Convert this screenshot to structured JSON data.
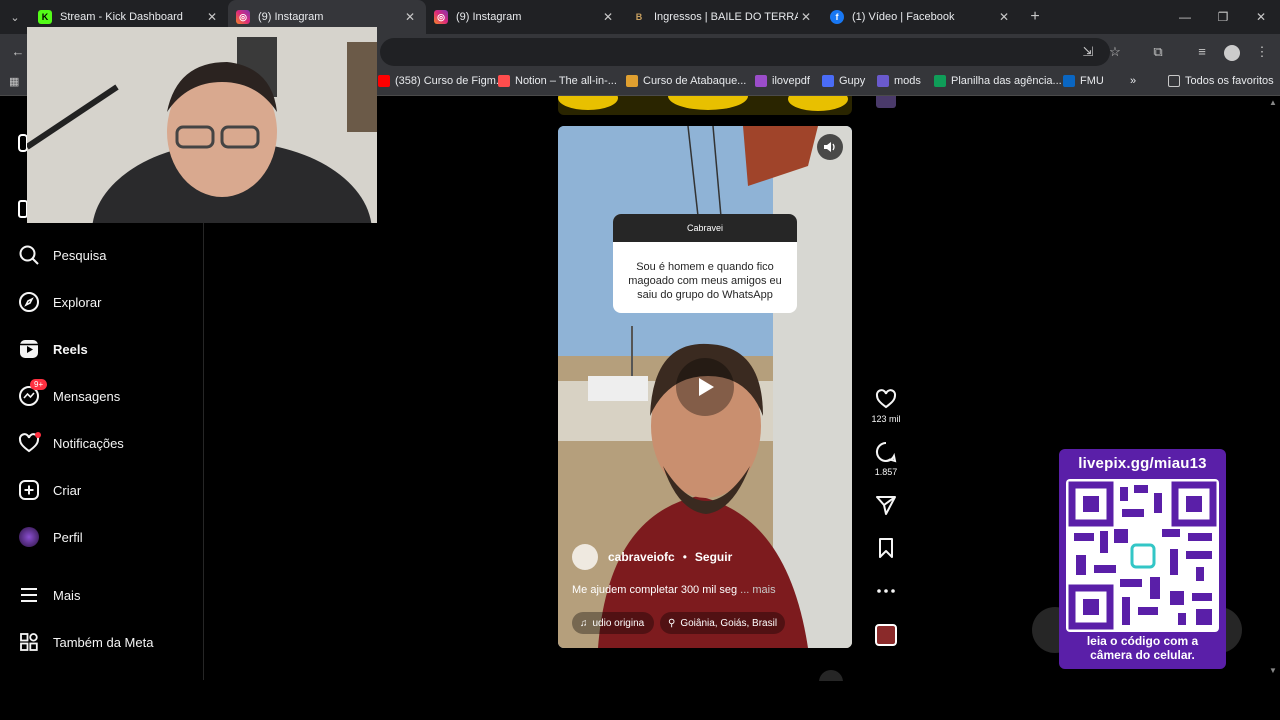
{
  "browser": {
    "tabs": [
      {
        "label": "Stream - Kick Dashboard",
        "icon": "kick-icon",
        "color": "#53fc18"
      },
      {
        "label": "(9) Instagram",
        "icon": "instagram-icon",
        "color": "#e1306c"
      },
      {
        "label": "(9) Instagram",
        "icon": "instagram-icon",
        "color": "#e1306c"
      },
      {
        "label": "Ingressos | BAILE DO TERRAÇO",
        "icon": "ticket-icon",
        "color": "#c8a060"
      },
      {
        "label": "(1) Vídeo | Facebook",
        "icon": "facebook-icon",
        "color": "#1877f2"
      }
    ],
    "bookmarks": [
      {
        "label": "(358) Curso de Figm...",
        "color": "#ff0000"
      },
      {
        "label": "Notion – The all-in-...",
        "color": "#ff4d4d"
      },
      {
        "label": "Curso de Atabaque...",
        "color": "#e0a030"
      },
      {
        "label": "ilovepdf",
        "color": "#9b4dca"
      },
      {
        "label": "Gupy",
        "color": "#4a6cf7"
      },
      {
        "label": "mods",
        "color": "#6a5acd"
      },
      {
        "label": "Planilha das agência...",
        "color": "#0f9d58"
      },
      {
        "label": "FMU",
        "color": "#0a66c2"
      }
    ],
    "all_favorites": "Todos os favoritos",
    "more_chevron": "»"
  },
  "sidebar": {
    "items": [
      {
        "label": "Pesquisa",
        "icon": "search-icon"
      },
      {
        "label": "Explorar",
        "icon": "compass-icon"
      },
      {
        "label": "Reels",
        "icon": "reels-icon"
      },
      {
        "label": "Mensagens",
        "icon": "messenger-icon",
        "badge": "9+"
      },
      {
        "label": "Notificações",
        "icon": "heart-icon"
      },
      {
        "label": "Criar",
        "icon": "plus-square-icon"
      },
      {
        "label": "Perfil",
        "icon": "avatar"
      },
      {
        "label": "Mais",
        "icon": "menu-icon"
      },
      {
        "label": "Também da Meta",
        "icon": "meta-grid-icon"
      }
    ]
  },
  "reel": {
    "question_header": "Cabravei",
    "question_text": "Sou é homem e quando fico magoado com meus amigos eu saiu do grupo do WhatsApp",
    "author": "cabraveiofc",
    "separator": "•",
    "follow": "Seguir",
    "caption": "Me ajudem completar 300 mil seg",
    "caption_more": "... mais",
    "audio": "udio origina",
    "location": "Goiânia, Goiás, Brasil",
    "likes": "123 mil",
    "comments": "1.857"
  },
  "overlay": {
    "url": "livepix.gg/miau13",
    "hint_line1": "leia o código com a",
    "hint_line2": "câmera do celular."
  }
}
